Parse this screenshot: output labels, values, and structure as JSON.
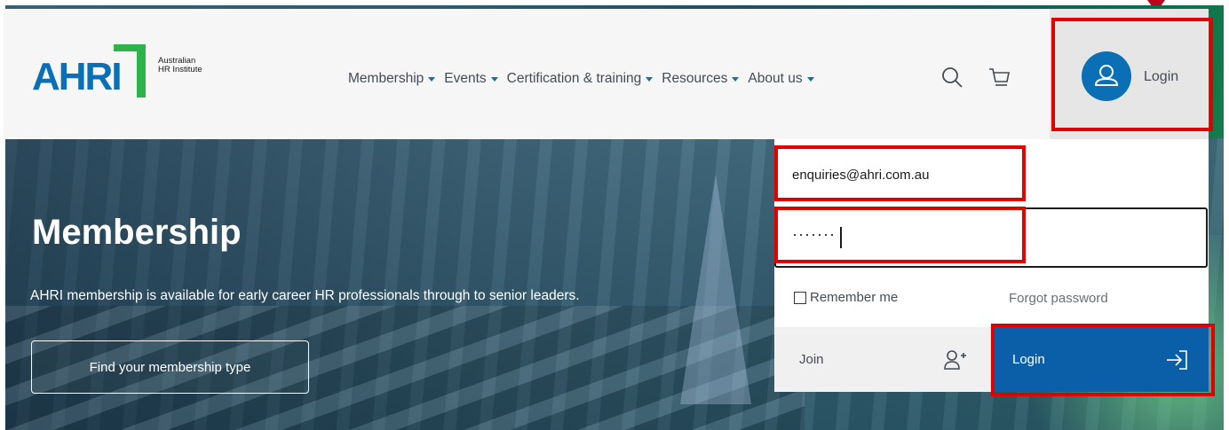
{
  "brand": {
    "logo_text": "AHRI",
    "logo_subtitle_line1": "Australian",
    "logo_subtitle_line2": "HR Institute"
  },
  "nav": {
    "items": [
      {
        "label": "Membership"
      },
      {
        "label": "Events"
      },
      {
        "label": "Certification & training"
      },
      {
        "label": "Resources"
      },
      {
        "label": "About us"
      }
    ]
  },
  "header": {
    "login_label": "Login",
    "icons": [
      "search-icon",
      "cart-icon",
      "user-icon"
    ]
  },
  "hero": {
    "title": "Membership",
    "description": "AHRI membership is available for early career HR professionals through to senior leaders.",
    "button_label": "Find your membership type"
  },
  "login_form": {
    "email_value": "enquiries@ahri.com.au",
    "password_masked": "·······",
    "remember_label": "Remember me",
    "forgot_label": "Forgot password",
    "join_label": "Join",
    "login_button_label": "Login"
  },
  "colors": {
    "brand_blue": "#0a6fb4",
    "brand_green": "#2db34a",
    "login_button": "#0a5fa8",
    "highlight": "#e00000"
  }
}
